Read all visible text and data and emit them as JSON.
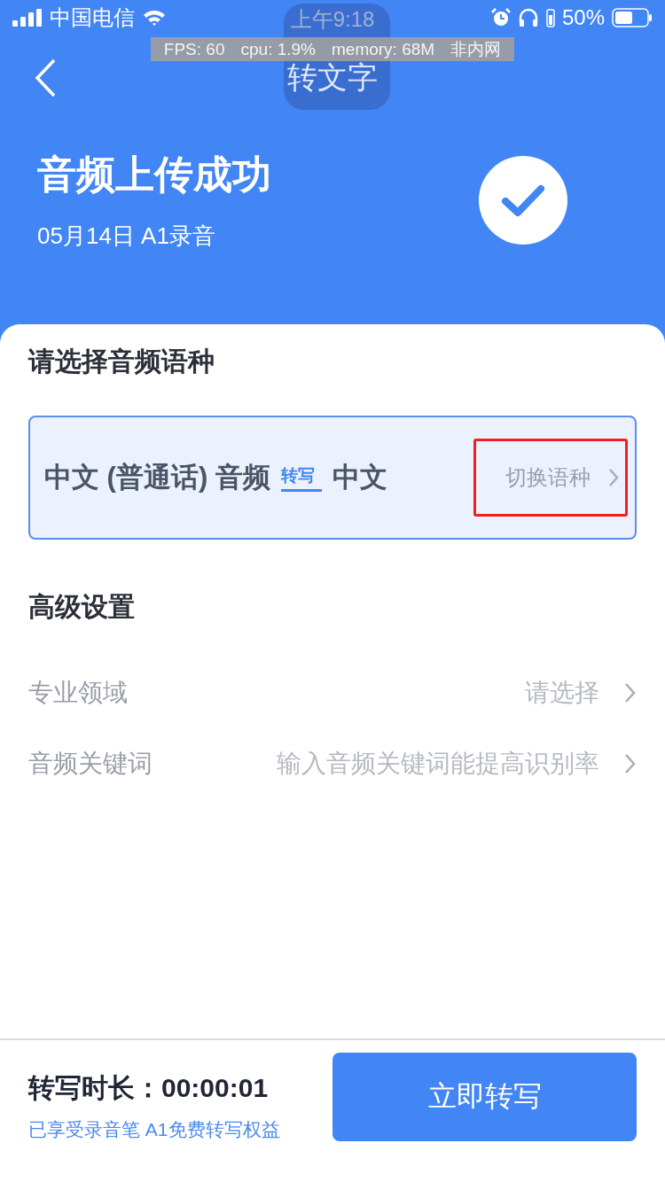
{
  "status_bar": {
    "carrier": "中国电信",
    "time": "上午9:18",
    "battery": "50%"
  },
  "debug_overlay": {
    "items": [
      "FPS: 60",
      "cpu: 1.9%",
      "memory: 68M",
      "非内网"
    ]
  },
  "nav": {
    "title": "转文字"
  },
  "header": {
    "title": "音频上传成功",
    "subtitle": "05月14日 A1录音"
  },
  "language_section": {
    "title": "请选择音频语种",
    "source": "中文 (普通话) 音频",
    "badge": "转写",
    "target": "中文",
    "switch": "切换语种",
    "highlighted": true
  },
  "advanced": {
    "title": "高级设置",
    "rows": [
      {
        "label": "专业领域",
        "value": "请选择"
      },
      {
        "label": "音频关键词",
        "value": "输入音频关键词能提高识别率"
      }
    ]
  },
  "footer": {
    "duration_label": "转写时长：",
    "duration": "00:00:01",
    "benefit": "已享受录音笔 A1免费转写权益",
    "button": "立即转写"
  }
}
